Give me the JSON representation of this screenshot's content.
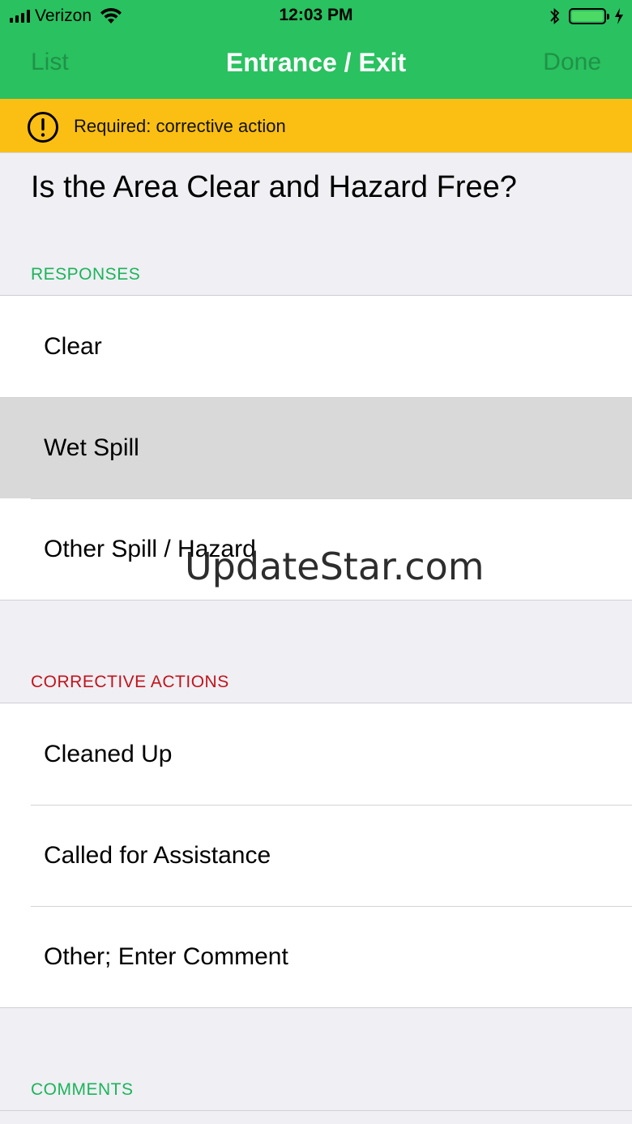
{
  "status": {
    "carrier": "Verizon",
    "time": "12:03 PM"
  },
  "nav": {
    "left": "List",
    "title": "Entrance / Exit",
    "right": "Done"
  },
  "banner": {
    "text": "Required: corrective action",
    "icon": "warning-circle-icon"
  },
  "question": "Is the Area Clear and Hazard Free?",
  "responses": {
    "header": "RESPONSES",
    "items": [
      {
        "label": "Clear"
      },
      {
        "label": "Wet Spill",
        "selected": true
      },
      {
        "label": "Other Spill / Hazard"
      }
    ]
  },
  "corrective": {
    "header": "CORRECTIVE ACTIONS",
    "items": [
      {
        "label": "Cleaned Up"
      },
      {
        "label": "Called for Assistance"
      },
      {
        "label": "Other; Enter Comment"
      }
    ]
  },
  "comments": {
    "header": "COMMENTS"
  },
  "watermark": "UpdateStar.com",
  "colors": {
    "brand_green": "#2ac160",
    "warning_yellow": "#fbbf13",
    "header_green": "#1db45a",
    "header_red": "#c0141b"
  }
}
